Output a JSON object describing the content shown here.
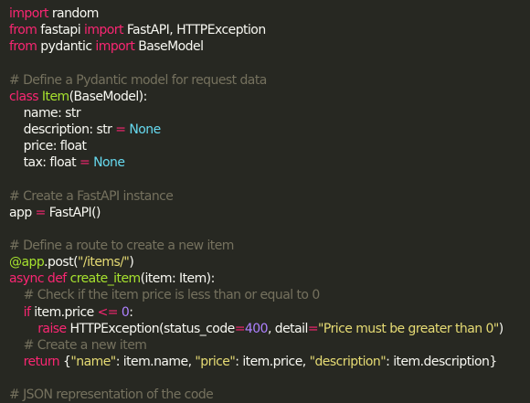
{
  "code_lines": [
    [
      {
        "t": "kw",
        "v": "import"
      },
      {
        "t": "plain",
        "v": " random"
      }
    ],
    [
      {
        "t": "kw",
        "v": "from"
      },
      {
        "t": "plain",
        "v": " fastapi "
      },
      {
        "t": "kw",
        "v": "import"
      },
      {
        "t": "plain",
        "v": " FastAPI, HTTPException"
      }
    ],
    [
      {
        "t": "kw",
        "v": "from"
      },
      {
        "t": "plain",
        "v": " pydantic "
      },
      {
        "t": "kw",
        "v": "import"
      },
      {
        "t": "plain",
        "v": " BaseModel"
      }
    ],
    [],
    [
      {
        "t": "cmt",
        "v": "# Define a Pydantic model for request data"
      }
    ],
    [
      {
        "t": "kw",
        "v": "class"
      },
      {
        "t": "plain",
        "v": " "
      },
      {
        "t": "cls",
        "v": "Item"
      },
      {
        "t": "plain",
        "v": "(BaseModel):"
      }
    ],
    [
      {
        "t": "plain",
        "v": "    name: str"
      }
    ],
    [
      {
        "t": "plain",
        "v": "    description: str "
      },
      {
        "t": "op",
        "v": "="
      },
      {
        "t": "plain",
        "v": " "
      },
      {
        "t": "const",
        "v": "None"
      }
    ],
    [
      {
        "t": "plain",
        "v": "    price: float"
      }
    ],
    [
      {
        "t": "plain",
        "v": "    tax: float "
      },
      {
        "t": "op",
        "v": "="
      },
      {
        "t": "plain",
        "v": " "
      },
      {
        "t": "const",
        "v": "None"
      }
    ],
    [],
    [
      {
        "t": "cmt",
        "v": "# Create a FastAPI instance"
      }
    ],
    [
      {
        "t": "plain",
        "v": "app "
      },
      {
        "t": "op",
        "v": "="
      },
      {
        "t": "plain",
        "v": " FastAPI()"
      }
    ],
    [],
    [
      {
        "t": "cmt",
        "v": "# Define a route to create a new item"
      }
    ],
    [
      {
        "t": "dec",
        "v": "@app"
      },
      {
        "t": "plain",
        "v": ".post("
      },
      {
        "t": "str",
        "v": "\"/items/\""
      },
      {
        "t": "plain",
        "v": ")"
      }
    ],
    [
      {
        "t": "kw",
        "v": "async"
      },
      {
        "t": "plain",
        "v": " "
      },
      {
        "t": "kw",
        "v": "def"
      },
      {
        "t": "plain",
        "v": " "
      },
      {
        "t": "fn",
        "v": "create_item"
      },
      {
        "t": "plain",
        "v": "(item: Item):"
      }
    ],
    [
      {
        "t": "plain",
        "v": "    "
      },
      {
        "t": "cmt",
        "v": "# Check if the item price is less than or equal to 0"
      }
    ],
    [
      {
        "t": "plain",
        "v": "    "
      },
      {
        "t": "kw",
        "v": "if"
      },
      {
        "t": "plain",
        "v": " item.price "
      },
      {
        "t": "op",
        "v": "<="
      },
      {
        "t": "plain",
        "v": " "
      },
      {
        "t": "num",
        "v": "0"
      },
      {
        "t": "plain",
        "v": ":"
      }
    ],
    [
      {
        "t": "plain",
        "v": "        "
      },
      {
        "t": "kw",
        "v": "raise"
      },
      {
        "t": "plain",
        "v": " HTTPException(status_code"
      },
      {
        "t": "op",
        "v": "="
      },
      {
        "t": "num",
        "v": "400"
      },
      {
        "t": "plain",
        "v": ", detail"
      },
      {
        "t": "op",
        "v": "="
      },
      {
        "t": "str",
        "v": "\"Price must be greater than 0\""
      },
      {
        "t": "plain",
        "v": ")"
      }
    ],
    [
      {
        "t": "plain",
        "v": "    "
      },
      {
        "t": "cmt",
        "v": "# Create a new item"
      }
    ],
    [
      {
        "t": "plain",
        "v": "    "
      },
      {
        "t": "kw",
        "v": "return"
      },
      {
        "t": "plain",
        "v": " {"
      },
      {
        "t": "str",
        "v": "\"name\""
      },
      {
        "t": "plain",
        "v": ": item.name, "
      },
      {
        "t": "str",
        "v": "\"price\""
      },
      {
        "t": "plain",
        "v": ": item.price, "
      },
      {
        "t": "str",
        "v": "\"description\""
      },
      {
        "t": "plain",
        "v": ": item.description}"
      }
    ],
    [],
    [
      {
        "t": "cmt",
        "v": "# JSON representation of the code"
      }
    ]
  ],
  "colors": {
    "background": "#272822",
    "text": "#f8f8f2",
    "keyword": "#f92672",
    "class_function": "#a6e22e",
    "constant": "#66d9ef",
    "string": "#e6db74",
    "number": "#ae81ff",
    "comment": "#75715e"
  }
}
